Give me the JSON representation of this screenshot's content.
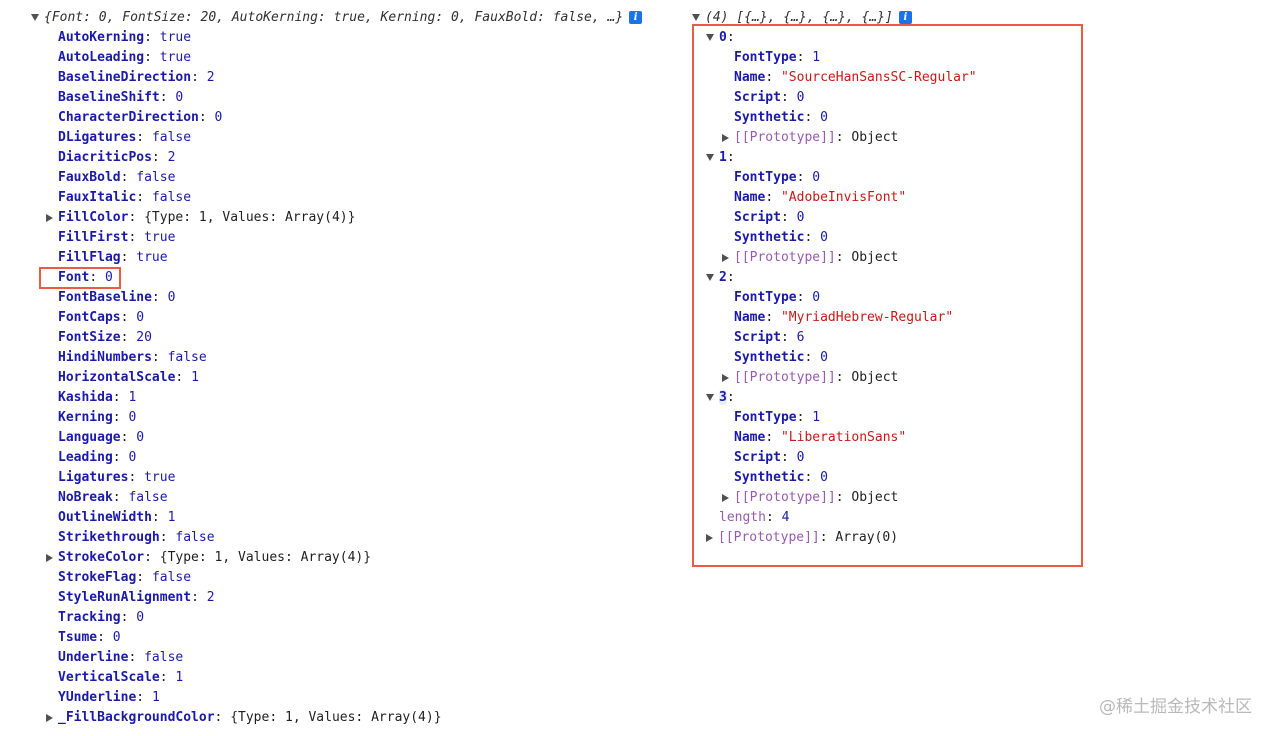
{
  "left": {
    "summary": "{Font: 0, FontSize: 20, AutoKerning: true, Kerning: 0, FauxBold: false, …}",
    "props": [
      {
        "key": "AutoKerning",
        "value": "true",
        "type": "bool"
      },
      {
        "key": "AutoLeading",
        "value": "true",
        "type": "bool"
      },
      {
        "key": "BaselineDirection",
        "value": "2",
        "type": "num"
      },
      {
        "key": "BaselineShift",
        "value": "0",
        "type": "num"
      },
      {
        "key": "CharacterDirection",
        "value": "0",
        "type": "num"
      },
      {
        "key": "DLigatures",
        "value": "false",
        "type": "bool"
      },
      {
        "key": "DiacriticPos",
        "value": "2",
        "type": "num"
      },
      {
        "key": "FauxBold",
        "value": "false",
        "type": "bool"
      },
      {
        "key": "FauxItalic",
        "value": "false",
        "type": "bool"
      },
      {
        "key": "FillColor",
        "value": "{Type: 1, Values: Array(4)}",
        "type": "obj",
        "expandable": true
      },
      {
        "key": "FillFirst",
        "value": "true",
        "type": "bool"
      },
      {
        "key": "FillFlag",
        "value": "true",
        "type": "bool"
      },
      {
        "key": "Font",
        "value": "0",
        "type": "num",
        "highlight": true
      },
      {
        "key": "FontBaseline",
        "value": "0",
        "type": "num"
      },
      {
        "key": "FontCaps",
        "value": "0",
        "type": "num"
      },
      {
        "key": "FontSize",
        "value": "20",
        "type": "num"
      },
      {
        "key": "HindiNumbers",
        "value": "false",
        "type": "bool"
      },
      {
        "key": "HorizontalScale",
        "value": "1",
        "type": "num"
      },
      {
        "key": "Kashida",
        "value": "1",
        "type": "num"
      },
      {
        "key": "Kerning",
        "value": "0",
        "type": "num"
      },
      {
        "key": "Language",
        "value": "0",
        "type": "num"
      },
      {
        "key": "Leading",
        "value": "0",
        "type": "num"
      },
      {
        "key": "Ligatures",
        "value": "true",
        "type": "bool"
      },
      {
        "key": "NoBreak",
        "value": "false",
        "type": "bool"
      },
      {
        "key": "OutlineWidth",
        "value": "1",
        "type": "num"
      },
      {
        "key": "Strikethrough",
        "value": "false",
        "type": "bool"
      },
      {
        "key": "StrokeColor",
        "value": "{Type: 1, Values: Array(4)}",
        "type": "obj",
        "expandable": true
      },
      {
        "key": "StrokeFlag",
        "value": "false",
        "type": "bool"
      },
      {
        "key": "StyleRunAlignment",
        "value": "2",
        "type": "num"
      },
      {
        "key": "Tracking",
        "value": "0",
        "type": "num"
      },
      {
        "key": "Tsume",
        "value": "0",
        "type": "num"
      },
      {
        "key": "Underline",
        "value": "false",
        "type": "bool"
      },
      {
        "key": "VerticalScale",
        "value": "1",
        "type": "num"
      },
      {
        "key": "YUnderline",
        "value": "1",
        "type": "num"
      },
      {
        "key": "_FillBackgroundColor",
        "value": "{Type: 1, Values: Array(4)}",
        "type": "obj",
        "expandable": true
      }
    ]
  },
  "right": {
    "summary": "(4) [{…}, {…}, {…}, {…}]",
    "items": [
      {
        "index": "0",
        "FontType": "1",
        "Name": "\"SourceHanSansSC-Regular\"",
        "Script": "0",
        "Synthetic": "0"
      },
      {
        "index": "1",
        "FontType": "0",
        "Name": "\"AdobeInvisFont\"",
        "Script": "0",
        "Synthetic": "0"
      },
      {
        "index": "2",
        "FontType": "0",
        "Name": "\"MyriadHebrew-Regular\"",
        "Script": "6",
        "Synthetic": "0"
      },
      {
        "index": "3",
        "FontType": "1",
        "Name": "\"LiberationSans\"",
        "Script": "0",
        "Synthetic": "0",
        "hover": true
      }
    ],
    "labels": {
      "font_type": "FontType",
      "name": "Name",
      "script": "Script",
      "synthetic": "Synthetic",
      "proto_key": "[[Prototype]]",
      "proto_obj": "Object",
      "length_key": "length",
      "length_val": "4",
      "array_proto_val": "Array(0)"
    }
  },
  "info_glyph": "i",
  "watermark": "@稀土掘金技术社区",
  "colors": {
    "highlight_box": "#ea5a47",
    "key": "#881280",
    "string": "#c41a16",
    "number": "#1a1aa6",
    "info_badge": "#1a73e8"
  }
}
